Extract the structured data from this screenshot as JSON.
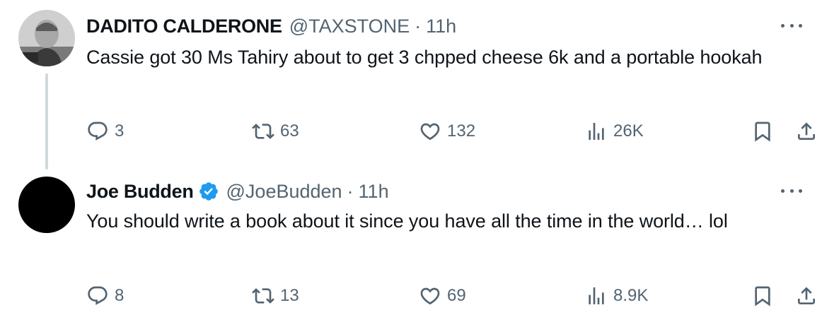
{
  "tweets": [
    {
      "name": "DADITO CALDERONE",
      "handle": "@TAXSTONE",
      "separator": "·",
      "time": "11h",
      "text": "Cassie got 30 Ms Tahiry about to get 3 chpped cheese 6k and a portable hookah",
      "verified": false,
      "stats": {
        "replies": "3",
        "retweets": "63",
        "likes": "132",
        "views": "26K"
      }
    },
    {
      "name": "Joe Budden",
      "handle": "@JoeBudden",
      "separator": "·",
      "time": "11h",
      "text": "You should write a book about it since you have all the time in the world… lol",
      "verified": true,
      "stats": {
        "replies": "8",
        "retweets": "13",
        "likes": "69",
        "views": "8.9K"
      }
    }
  ],
  "icons": {
    "reply": "reply-icon",
    "retweet": "retweet-icon",
    "like": "heart-icon",
    "views": "views-icon",
    "bookmark": "bookmark-icon",
    "share": "share-icon",
    "more": "more-icon",
    "verified": "verified-badge-icon"
  },
  "colors": {
    "text": "#0f1419",
    "secondary": "#536471",
    "verified": "#1d9bf0",
    "thread_line": "#cfd9de"
  }
}
